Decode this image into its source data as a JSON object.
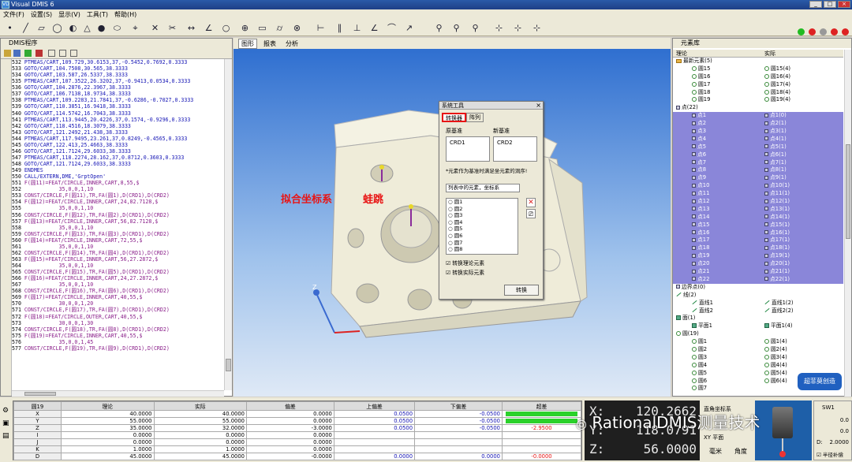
{
  "window": {
    "title": "Visual DMIS 6",
    "logo": "VD",
    "buttons": [
      "_",
      "□",
      "×"
    ]
  },
  "menu": [
    "文件(F)",
    "设置(S)",
    "显示(V)",
    "工具(T)",
    "帮助(H)"
  ],
  "program_panel": {
    "title": "DMIS程序",
    "lines": [
      {
        "n": "532",
        "t": "PTMEAS/CART,109.729,30.6153,37,-0.5452,0.7692,0.3333",
        "k": "c"
      },
      {
        "n": "533",
        "t": "GOTO/CART,104.7508,30.565,38.3333",
        "k": "c"
      },
      {
        "n": "534",
        "t": "GOTO/CART,103.587,26.5337,38.3333",
        "k": "c"
      },
      {
        "n": "535",
        "t": "PTMEAS/CART,107.3522,26.3202,37,-0.9413,0.0534,0.3333",
        "k": "c"
      },
      {
        "n": "536",
        "t": "GOTO/CART,104.2876,22.3967,38.3333",
        "k": "c"
      },
      {
        "n": "537",
        "t": "GOTO/CART,106.7138,18.9734,38.3333",
        "k": "c"
      },
      {
        "n": "538",
        "t": "PTMEAS/CART,109.2283,21.7841,37,-0.6286,-0.7027,0.3333",
        "k": "c"
      },
      {
        "n": "539",
        "t": "GOTO/CART,110.3851,16.9418,38.3333",
        "k": "c"
      },
      {
        "n": "540",
        "t": "GOTO/CART,114.5742,16.7043,38.3333",
        "k": "c"
      },
      {
        "n": "541",
        "t": "PTMEAS/CART,113.9445,20.4226,37,0.1574,-0.9296,0.3333",
        "k": "c"
      },
      {
        "n": "542",
        "t": "GOTO/CART,118.4516,18.3079,38.3333",
        "k": "c"
      },
      {
        "n": "543",
        "t": "GOTO/CART,121.2492,21.438,38.3333",
        "k": "c"
      },
      {
        "n": "544",
        "t": "PTMEAS/CART,117.9495,23.261,37,0.8249,-0.4565,0.3333",
        "k": "c"
      },
      {
        "n": "545",
        "t": "GOTO/CART,122.413,25.4663,38.3333",
        "k": "c"
      },
      {
        "n": "546",
        "t": "GOTO/CART,121.7124,29.6033,38.3333",
        "k": "c"
      },
      {
        "n": "547",
        "t": "PTMEAS/CART,118.2274,28.162,37,0.8712,0.3603,0.3333",
        "k": "c"
      },
      {
        "n": "548",
        "t": "GOTO/CART,121.7124,29.6033,38.3333",
        "k": "c"
      },
      {
        "n": "549",
        "t": "ENDMES",
        "k": "c"
      },
      {
        "n": "550",
        "t": "CALL/EXTERN,DME,'GrptOpen'",
        "k": "c"
      },
      {
        "n": "551",
        "t": "F(圆11)=FEAT/CIRCLE,INNER,CART,8,55,$",
        "k": "e"
      },
      {
        "n": "552",
        "t": "           35,0,0,1,10",
        "k": "e"
      },
      {
        "n": "553",
        "t": "CONST/CIRCLE,F(圆11),TR,FA(圆1),D(CRD1),D(CRD2)",
        "k": "e"
      },
      {
        "n": "554",
        "t": "F(圆12)=FEAT/CIRCLE,INNER,CART,24,82.7128,$",
        "k": "e"
      },
      {
        "n": "555",
        "t": "           35,0,0,1,10",
        "k": "e"
      },
      {
        "n": "556",
        "t": "CONST/CIRCLE,F(圆12),TR,FA(圆2),D(CRD1),D(CRD2)",
        "k": "e"
      },
      {
        "n": "557",
        "t": "F(圆13)=FEAT/CIRCLE,INNER,CART,56,82.7128,$",
        "k": "e"
      },
      {
        "n": "558",
        "t": "           35,0,0,1,10",
        "k": "e"
      },
      {
        "n": "559",
        "t": "CONST/CIRCLE,F(圆13),TR,FA(圆3),D(CRD1),D(CRD2)",
        "k": "e"
      },
      {
        "n": "560",
        "t": "F(圆14)=FEAT/CIRCLE,INNER,CART,72,55,$",
        "k": "e"
      },
      {
        "n": "561",
        "t": "           35,0,0,1,10",
        "k": "e"
      },
      {
        "n": "562",
        "t": "CONST/CIRCLE,F(圆14),TR,FA(圆4),D(CRD1),D(CRD2)",
        "k": "e"
      },
      {
        "n": "563",
        "t": "F(圆15)=FEAT/CIRCLE,INNER,CART,56,27.2872,$",
        "k": "e"
      },
      {
        "n": "564",
        "t": "           35,0,0,1,10",
        "k": "e"
      },
      {
        "n": "565",
        "t": "CONST/CIRCLE,F(圆15),TR,FA(圆5),D(CRD1),D(CRD2)",
        "k": "e"
      },
      {
        "n": "566",
        "t": "F(圆16)=FEAT/CIRCLE,INNER,CART,24,27.2872,$",
        "k": "e"
      },
      {
        "n": "567",
        "t": "           35,0,0,1,10",
        "k": "e"
      },
      {
        "n": "568",
        "t": "CONST/CIRCLE,F(圆16),TR,FA(圆6),D(CRD1),D(CRD2)",
        "k": "e"
      },
      {
        "n": "569",
        "t": "F(圆17)=FEAT/CIRCLE,INNER,CART,40,55,$",
        "k": "e"
      },
      {
        "n": "570",
        "t": "           30,0,0,1,20",
        "k": "e"
      },
      {
        "n": "571",
        "t": "CONST/CIRCLE,F(圆17),TR,FA(圆7),D(CRD1),D(CRD2)",
        "k": "e"
      },
      {
        "n": "572",
        "t": "F(圆18)=FEAT/CIRCLE,OUTER,CART,40,55,$",
        "k": "e"
      },
      {
        "n": "573",
        "t": "           30,0,0,1,30",
        "k": "e"
      },
      {
        "n": "574",
        "t": "CONST/CIRCLE,F(圆18),TR,FA(圆8),D(CRD1),D(CRD2)",
        "k": "e"
      },
      {
        "n": "575",
        "t": "F(圆19)=FEAT/CIRCLE,INNER,CART,40,55,$",
        "k": "e"
      },
      {
        "n": "576",
        "t": "           35,0,0,1,45",
        "k": "e"
      },
      {
        "n": "577",
        "t": "CONST/CIRCLE,F(圆19),TR,FA(圆9),D(CRD1),D(CRD2)",
        "k": "e"
      }
    ]
  },
  "graphics": {
    "tabs": [
      "图形",
      "报表",
      "分析"
    ],
    "annotation_left": "拟合坐标系",
    "annotation_right": "蛙跳",
    "axis_label": "Z"
  },
  "dialog": {
    "title": "系统工具",
    "close": "×",
    "tabs": [
      "转换器",
      "阵列"
    ],
    "src_label": "原基准",
    "dst_label": "新基准",
    "src_value": "CRD1",
    "dst_value": "CRD2",
    "note": "*元素作为基准时满足坐元素的洞序!",
    "filter": "列表中的元素，坐标系",
    "items": [
      "圆1",
      "圆2",
      "圆3",
      "圆4",
      "圆5",
      "圆6",
      "圆7",
      "圆8"
    ],
    "check_theory": "转换理论元素",
    "check_actual": "转换实际元素",
    "button": "转换"
  },
  "feature_panel": {
    "title": "元素库",
    "col_theory": "理论",
    "col_actual": "实际",
    "rows": [
      {
        "a": "最新元素(5)",
        "b": "",
        "t": "fo",
        "lv": 0,
        "sel": false
      },
      {
        "a": "圆15",
        "b": "圆15(4)",
        "t": "ci",
        "lv": 2,
        "sel": false
      },
      {
        "a": "圆16",
        "b": "圆16(4)",
        "t": "ci",
        "lv": 2,
        "sel": false
      },
      {
        "a": "圆17",
        "b": "圆17(4)",
        "t": "ci",
        "lv": 2,
        "sel": false
      },
      {
        "a": "圆18",
        "b": "圆18(4)",
        "t": "ci",
        "lv": 2,
        "sel": false
      },
      {
        "a": "圆19",
        "b": "圆19(4)",
        "t": "ci",
        "lv": 2,
        "sel": false
      },
      {
        "a": "点(22)",
        "b": "",
        "t": "pt",
        "lv": 0,
        "sel": false
      },
      {
        "a": "点1",
        "b": "点1(0)",
        "t": "pt",
        "lv": 2,
        "sel": true
      },
      {
        "a": "点2",
        "b": "点2(1)",
        "t": "pt",
        "lv": 2,
        "sel": true
      },
      {
        "a": "点3",
        "b": "点3(1)",
        "t": "pt",
        "lv": 2,
        "sel": true
      },
      {
        "a": "点4",
        "b": "点4(1)",
        "t": "pt",
        "lv": 2,
        "sel": true
      },
      {
        "a": "点5",
        "b": "点5(1)",
        "t": "pt",
        "lv": 2,
        "sel": true
      },
      {
        "a": "点6",
        "b": "点6(1)",
        "t": "pt",
        "lv": 2,
        "sel": true
      },
      {
        "a": "点7",
        "b": "点7(1)",
        "t": "pt",
        "lv": 2,
        "sel": true
      },
      {
        "a": "点8",
        "b": "点8(1)",
        "t": "pt",
        "lv": 2,
        "sel": true
      },
      {
        "a": "点9",
        "b": "点9(1)",
        "t": "pt",
        "lv": 2,
        "sel": true
      },
      {
        "a": "点10",
        "b": "点10(1)",
        "t": "pt",
        "lv": 2,
        "sel": true
      },
      {
        "a": "点11",
        "b": "点11(1)",
        "t": "pt",
        "lv": 2,
        "sel": true
      },
      {
        "a": "点12",
        "b": "点12(1)",
        "t": "pt",
        "lv": 2,
        "sel": true
      },
      {
        "a": "点13",
        "b": "点13(1)",
        "t": "pt",
        "lv": 2,
        "sel": true
      },
      {
        "a": "点14",
        "b": "点14(1)",
        "t": "pt",
        "lv": 2,
        "sel": true
      },
      {
        "a": "点15",
        "b": "点15(1)",
        "t": "pt",
        "lv": 2,
        "sel": true
      },
      {
        "a": "点16",
        "b": "点16(1)",
        "t": "pt",
        "lv": 2,
        "sel": true
      },
      {
        "a": "点17",
        "b": "点17(1)",
        "t": "pt",
        "lv": 2,
        "sel": true
      },
      {
        "a": "点18",
        "b": "点18(1)",
        "t": "pt",
        "lv": 2,
        "sel": true
      },
      {
        "a": "点19",
        "b": "点19(1)",
        "t": "pt",
        "lv": 2,
        "sel": true
      },
      {
        "a": "点20",
        "b": "点20(1)",
        "t": "pt",
        "lv": 2,
        "sel": true
      },
      {
        "a": "点21",
        "b": "点21(1)",
        "t": "pt",
        "lv": 2,
        "sel": true
      },
      {
        "a": "点22",
        "b": "点22(1)",
        "t": "pt",
        "lv": 2,
        "sel": true
      },
      {
        "a": "边界点(0)",
        "b": "",
        "t": "pt",
        "lv": 0,
        "sel": false
      },
      {
        "a": "线(2)",
        "b": "",
        "t": "ln2",
        "lv": 0,
        "sel": false
      },
      {
        "a": "直线1",
        "b": "直线1(2)",
        "t": "ln2",
        "lv": 2,
        "sel": false
      },
      {
        "a": "直线2",
        "b": "直线2(2)",
        "t": "ln2",
        "lv": 2,
        "sel": false
      },
      {
        "a": "面(1)",
        "b": "",
        "t": "pl",
        "lv": 0,
        "sel": false
      },
      {
        "a": "平面1",
        "b": "平面1(4)",
        "t": "pl",
        "lv": 2,
        "sel": false
      },
      {
        "a": "圆(19)",
        "b": "",
        "t": "ci",
        "lv": 0,
        "sel": false
      },
      {
        "a": "圆1",
        "b": "圆1(4)",
        "t": "ci",
        "lv": 2,
        "sel": false
      },
      {
        "a": "圆2",
        "b": "圆2(4)",
        "t": "ci",
        "lv": 2,
        "sel": false
      },
      {
        "a": "圆3",
        "b": "圆3(4)",
        "t": "ci",
        "lv": 2,
        "sel": false
      },
      {
        "a": "圆4",
        "b": "圆4(4)",
        "t": "ci",
        "lv": 2,
        "sel": false
      },
      {
        "a": "圆5",
        "b": "圆5(4)",
        "t": "ci",
        "lv": 2,
        "sel": false
      },
      {
        "a": "圆6",
        "b": "圆6(4)",
        "t": "ci",
        "lv": 2,
        "sel": false
      },
      {
        "a": "圆7",
        "b": "",
        "t": "ci",
        "lv": 2,
        "sel": false
      }
    ],
    "watermark": "超菲莫创造"
  },
  "results": {
    "title": "圆19",
    "headers": [
      "理论",
      "实际",
      "偏差",
      "上偏差",
      "下偏差",
      "超差"
    ],
    "rows": [
      {
        "k": "X",
        "th": "40.0000",
        "ac": "40.0000",
        "dev": "0.0000",
        "up": "0.0500",
        "lo": "-0.0500",
        "out": "",
        "bar": 0.5
      },
      {
        "k": "Y",
        "th": "55.0000",
        "ac": "55.0000",
        "dev": "0.0000",
        "up": "0.0500",
        "lo": "-0.0500",
        "out": "",
        "bar": 0.5
      },
      {
        "k": "Z",
        "th": "35.0000",
        "ac": "32.0000",
        "dev": "-3.0000",
        "up": "0.0500",
        "lo": "-0.0500",
        "out": "-2.9500",
        "bar": 0
      },
      {
        "k": "I",
        "th": "0.0000",
        "ac": "0.0000",
        "dev": "0.0000",
        "up": "",
        "lo": "",
        "out": "",
        "bar": -1
      },
      {
        "k": "J",
        "th": "0.0000",
        "ac": "0.0000",
        "dev": "0.0000",
        "up": "",
        "lo": "",
        "out": "",
        "bar": -1
      },
      {
        "k": "K",
        "th": "1.0000",
        "ac": "1.0000",
        "dev": "0.0000",
        "up": "",
        "lo": "",
        "out": "",
        "bar": -1
      },
      {
        "k": "D",
        "th": "45.0000",
        "ac": "45.0000",
        "dev": "-0.0000",
        "up": "0.0000",
        "lo": "0.0000",
        "out": "-0.0000",
        "bar": 0
      }
    ]
  },
  "dro": {
    "x_label": "X:",
    "x": "120.2662",
    "y_label": "Y:",
    "y": "118.0791",
    "z_label": "Z:",
    "z": "56.0000"
  },
  "dro_buttons": {
    "coord": "直角坐标系",
    "plane": "XY 平面",
    "unit": "毫米",
    "angle": "角度"
  },
  "probe_panel": {
    "name": "SW1",
    "r1": "0.0",
    "r2": "0.0",
    "d_label": "D:",
    "d": "2.0000",
    "comp": "半径补偿"
  },
  "watermark": "RationalDMIS测量技术"
}
